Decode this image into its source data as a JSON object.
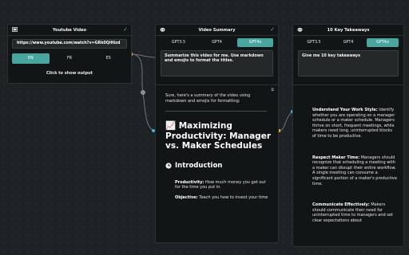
{
  "colors": {
    "accent": "#48a5a0",
    "background": "#1e2224",
    "node": "#121516",
    "port": "#e89a2c",
    "wire_dot": "#36b9d6"
  },
  "youtube_node": {
    "title": "Youtube Video",
    "icon": "film-icon",
    "url_value": "https://www.youtube.com/watch?v=GRk0QiHizd",
    "languages": [
      "EN",
      "FR",
      "ES"
    ],
    "selected_language": "EN",
    "footer": "Click to show output"
  },
  "summary_node": {
    "title": "Video Summary",
    "icon": "robot-icon",
    "models": [
      "GPT3.5",
      "GPT4",
      "GPT4o"
    ],
    "selected_model": "GPT4o",
    "prompt": "Summarize this video for me. Use markdown and emojis to format the titles.",
    "output": {
      "intro": "Sure, here's a summary of the video using markdown and emojis for formatting:",
      "heading_emoji": "📈",
      "heading": "Maximizing Productivity: Manager vs. Maker Schedules",
      "section_icon": "clock-icon",
      "section": "Introduction",
      "p1_label": "Productivity:",
      "p1_text": " How much money you get out for the time you put in.",
      "p2_label": "Objective:",
      "p2_text": " Teach you how to invest your time"
    }
  },
  "takeaways_node": {
    "title": "10 Key Takeaways",
    "icon": "robot-icon",
    "models": [
      "GPT3.5",
      "GPT4",
      "GPT4o"
    ],
    "selected_model": "GPT4o",
    "prompt": "Give me 10 key takeaways",
    "output": {
      "t1_label": "Understand Your Work Style:",
      "t1_text": " Identify whether you are operating on a manager schedule or a maker schedule. Managers thrive on short, frequent meetings, while makers need long, uninterrupted blocks of time to be productive.",
      "t2_label": "Respect Maker Time:",
      "t2_text": " Managers should recognize that scheduling a meeting with a maker can disrupt their entire workflow. A single meeting can consume a significant portion of a maker's productive time.",
      "t3_label": "Communicate Effectively:",
      "t3_text": " Makers should communicate their need for uninterrupted time to managers and set clear expectations about"
    }
  }
}
